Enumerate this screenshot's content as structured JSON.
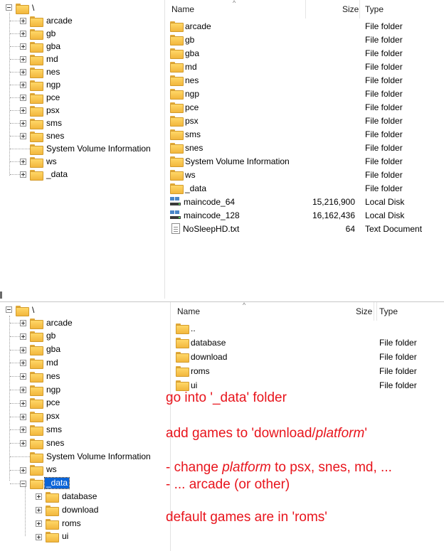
{
  "root_label": "\\",
  "top_tree": [
    "arcade",
    "gb",
    "gba",
    "md",
    "nes",
    "ngp",
    "pce",
    "psx",
    "sms",
    "snes",
    "System Volume Information",
    "ws",
    "_data"
  ],
  "columns": {
    "name": "Name",
    "size": "Size",
    "type": "Type"
  },
  "top_files": [
    {
      "name": "arcade",
      "size": "",
      "type": "File folder",
      "icon": "folder-icon"
    },
    {
      "name": "gb",
      "size": "",
      "type": "File folder",
      "icon": "folder-icon"
    },
    {
      "name": "gba",
      "size": "",
      "type": "File folder",
      "icon": "folder-icon"
    },
    {
      "name": "md",
      "size": "",
      "type": "File folder",
      "icon": "folder-icon"
    },
    {
      "name": "nes",
      "size": "",
      "type": "File folder",
      "icon": "folder-icon"
    },
    {
      "name": "ngp",
      "size": "",
      "type": "File folder",
      "icon": "folder-icon"
    },
    {
      "name": "pce",
      "size": "",
      "type": "File folder",
      "icon": "folder-icon"
    },
    {
      "name": "psx",
      "size": "",
      "type": "File folder",
      "icon": "folder-icon"
    },
    {
      "name": "sms",
      "size": "",
      "type": "File folder",
      "icon": "folder-icon"
    },
    {
      "name": "snes",
      "size": "",
      "type": "File folder",
      "icon": "folder-icon"
    },
    {
      "name": "System Volume Information",
      "size": "",
      "type": "File folder",
      "icon": "folder-icon"
    },
    {
      "name": "ws",
      "size": "",
      "type": "File folder",
      "icon": "folder-icon"
    },
    {
      "name": "_data",
      "size": "",
      "type": "File folder",
      "icon": "folder-icon"
    },
    {
      "name": "maincode_64",
      "size": "15,216,900",
      "type": "Local Disk",
      "icon": "disk-icon"
    },
    {
      "name": "maincode_128",
      "size": "16,162,436",
      "type": "Local Disk",
      "icon": "disk-icon"
    },
    {
      "name": "NoSleepHD.txt",
      "size": "64",
      "type": "Text Document",
      "icon": "text-file-icon"
    }
  ],
  "bottom_tree": [
    "arcade",
    "gb",
    "gba",
    "md",
    "nes",
    "ngp",
    "pce",
    "psx",
    "sms",
    "snes",
    "System Volume Information",
    "ws",
    "_data"
  ],
  "bottom_subtree": [
    "database",
    "download",
    "roms",
    "ui"
  ],
  "bottom_files": [
    {
      "name": "..",
      "type": ""
    },
    {
      "name": "database",
      "type": "File folder"
    },
    {
      "name": "download",
      "type": "File folder"
    },
    {
      "name": "roms",
      "type": "File folder"
    },
    {
      "name": "ui",
      "type": "File folder"
    }
  ],
  "notes": {
    "line1": "go into '_data' folder",
    "line2_a": "add games to 'download/",
    "line2_b": "platform",
    "line2_c": "'",
    "line3_a": "- change ",
    "line3_b": "platform",
    "line3_c": " to psx, snes, md, ...",
    "line4": "- ... arcade (or other)",
    "line5": "default games are in 'roms'"
  },
  "colors": {
    "annotation": "#e8141c",
    "selection": "#0a64d8",
    "folder": "#f2b73d"
  }
}
